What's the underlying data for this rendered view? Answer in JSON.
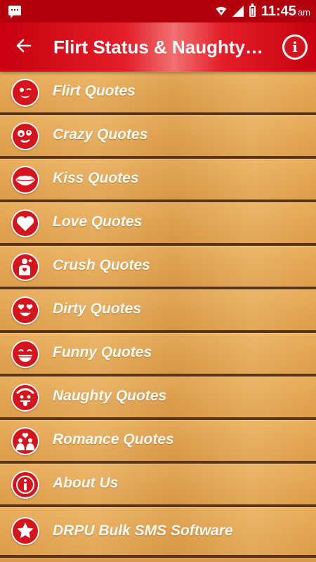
{
  "status_bar": {
    "time": "11:45",
    "ampm": "am",
    "icons": [
      "message-icon",
      "wifi-icon",
      "signal-icon",
      "battery-icon"
    ]
  },
  "app_bar": {
    "title": "Flirt Status & Naughty…",
    "back_icon": "back-arrow-icon",
    "info_icon": "info-icon",
    "info_glyph": "i"
  },
  "colors": {
    "primary_red": "#d6141e",
    "status_bar": "#b3000c",
    "wood": "#e3a452",
    "divider": "#5a3414",
    "label_text": "#fffdf5"
  },
  "menu": [
    {
      "label": "Flirt Quotes",
      "icon": "flirt-face-icon"
    },
    {
      "label": "Crazy Quotes",
      "icon": "crazy-face-icon"
    },
    {
      "label": "Kiss Quotes",
      "icon": "kiss-lips-icon"
    },
    {
      "label": "Love Quotes",
      "icon": "heart-icon"
    },
    {
      "label": "Crush Quotes",
      "icon": "crush-person-icon"
    },
    {
      "label": "Dirty Quotes",
      "icon": "heart-eyes-face-icon"
    },
    {
      "label": "Funny Quotes",
      "icon": "grin-face-icon"
    },
    {
      "label": "Naughty Quotes",
      "icon": "tongue-face-icon"
    },
    {
      "label": "Romance Quotes",
      "icon": "romance-couple-icon"
    },
    {
      "label": "About Us",
      "icon": "info-icon"
    },
    {
      "label": "DRPU Bulk SMS Software",
      "icon": "star-icon"
    }
  ]
}
